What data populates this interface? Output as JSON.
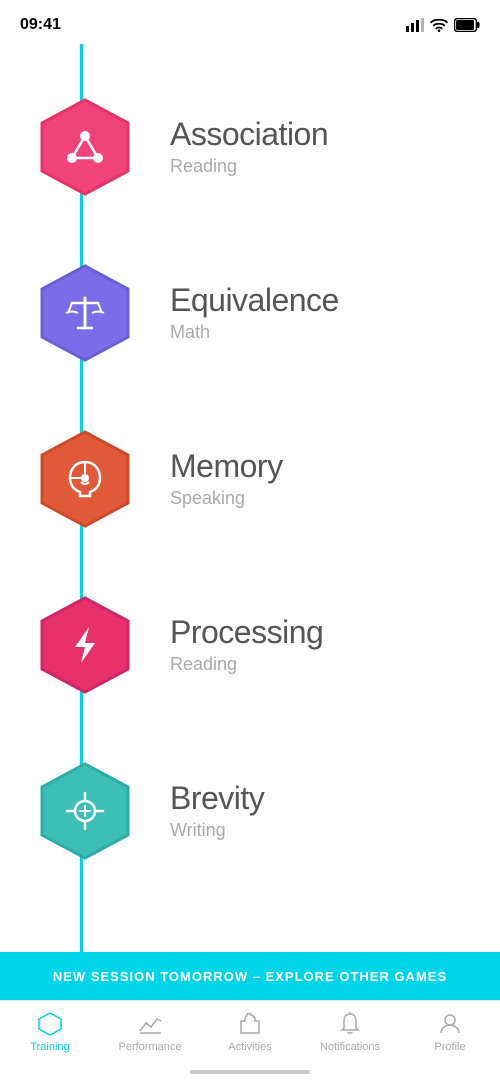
{
  "statusBar": {
    "time": "09:41"
  },
  "games": [
    {
      "id": "association",
      "title": "Association",
      "subtitle": "Reading",
      "color1": "#f0437a",
      "color2": "#e8306b",
      "iconType": "nodes"
    },
    {
      "id": "equivalence",
      "title": "Equivalence",
      "subtitle": "Math",
      "color1": "#6b5fd4",
      "color2": "#7b6de8",
      "iconType": "scale"
    },
    {
      "id": "memory",
      "title": "Memory",
      "subtitle": "Speaking",
      "color1": "#e05a3a",
      "color2": "#d04a2a",
      "iconType": "head"
    },
    {
      "id": "processing",
      "title": "Processing",
      "subtitle": "Reading",
      "color1": "#e8306b",
      "color2": "#d0256a",
      "iconType": "flash"
    },
    {
      "id": "brevity",
      "title": "Brevity",
      "subtitle": "Writing",
      "color1": "#3dbfb8",
      "color2": "#2dada8",
      "iconType": "crosshair"
    }
  ],
  "banner": {
    "text": "NEW SESSION TOMORROW  –  EXPLORE OTHER GAMES"
  },
  "tabs": [
    {
      "id": "training",
      "label": "Training",
      "active": true,
      "iconType": "hexagon"
    },
    {
      "id": "performance",
      "label": "Performance",
      "active": false,
      "iconType": "chart"
    },
    {
      "id": "activities",
      "label": "Activities",
      "active": false,
      "iconType": "puzzle"
    },
    {
      "id": "notifications",
      "label": "Notifications",
      "active": false,
      "iconType": "bell"
    },
    {
      "id": "profile",
      "label": "Profile",
      "active": false,
      "iconType": "person"
    }
  ]
}
